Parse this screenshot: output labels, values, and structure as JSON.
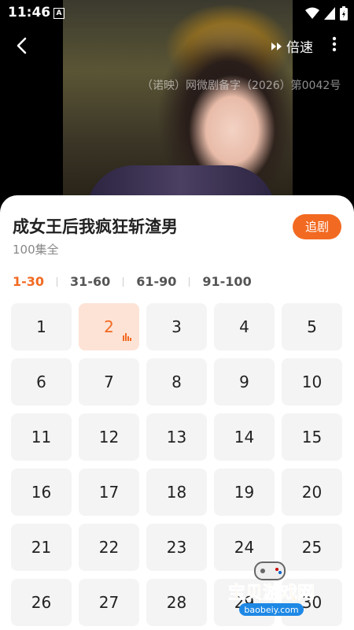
{
  "status": {
    "time": "11:46",
    "a_icon": "A"
  },
  "header": {
    "speed_label": "倍速",
    "license_text": "（诺映）网微剧备字（2026）第0042号"
  },
  "drama": {
    "title": "成女王后我疯狂斩渣男",
    "episodes_total": "100集全",
    "follow_label": "追剧"
  },
  "tabs": [
    "1-30",
    "31-60",
    "61-90",
    "91-100"
  ],
  "active_tab": 0,
  "episodes": [
    "1",
    "2",
    "3",
    "4",
    "5",
    "6",
    "7",
    "8",
    "9",
    "10",
    "11",
    "12",
    "13",
    "14",
    "15",
    "16",
    "17",
    "18",
    "19",
    "20",
    "21",
    "22",
    "23",
    "24",
    "25",
    "26",
    "27",
    "28",
    "29",
    "30"
  ],
  "active_episode": 1,
  "watermark": {
    "main": "宝贝游戏网",
    "url": "baobeiy.com"
  },
  "colors": {
    "accent": "#f26a22",
    "active_cell_bg": "#fde3d6",
    "cell_bg": "#f4f4f4"
  }
}
